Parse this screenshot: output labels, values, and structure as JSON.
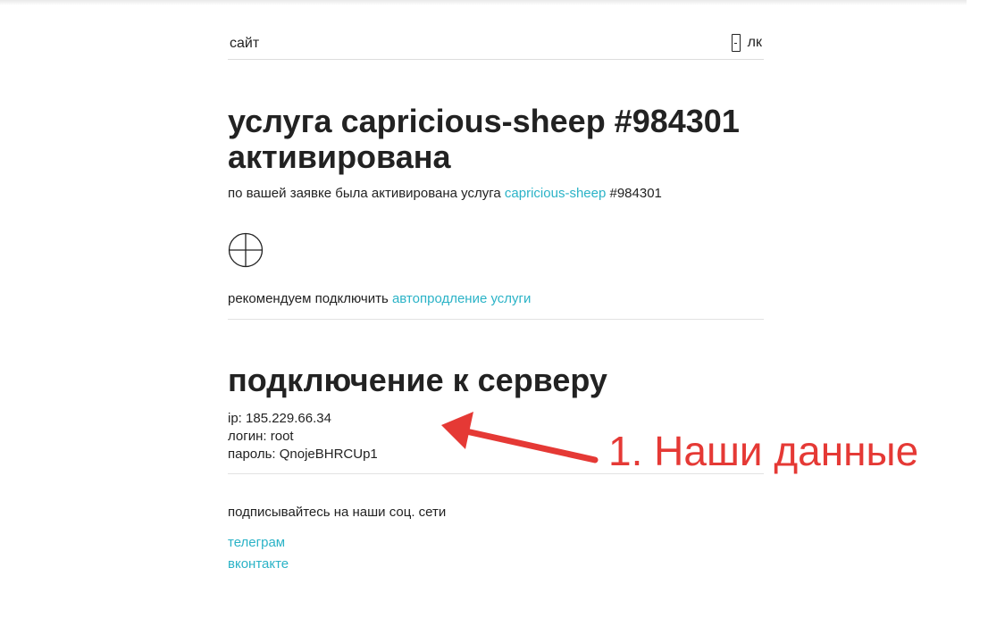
{
  "header": {
    "site_label": "сайт",
    "account_label": "лк"
  },
  "service": {
    "title": "услуга capricious-sheep #984301 активирована",
    "activation_prefix": "по вашей заявке была активирована услуга ",
    "service_name": "capricious-sheep",
    "service_id": " #984301",
    "recommend_prefix": "рекомендуем подключить ",
    "autorenew_link": "автопродление услуги"
  },
  "server": {
    "title": "подключение к серверу",
    "ip_line": "ip: 185.229.66.34",
    "login_line": "логин: root",
    "password_line": "пароль: QnojeBHRCUp1"
  },
  "social": {
    "title": "подписывайтесь на наши соц. сети",
    "links": [
      "телеграм",
      "вконтакте"
    ]
  },
  "annotation": {
    "text": "1. Наши данные",
    "color": "#e53935"
  },
  "colors": {
    "link": "#2bb3c7",
    "text": "#222222"
  }
}
